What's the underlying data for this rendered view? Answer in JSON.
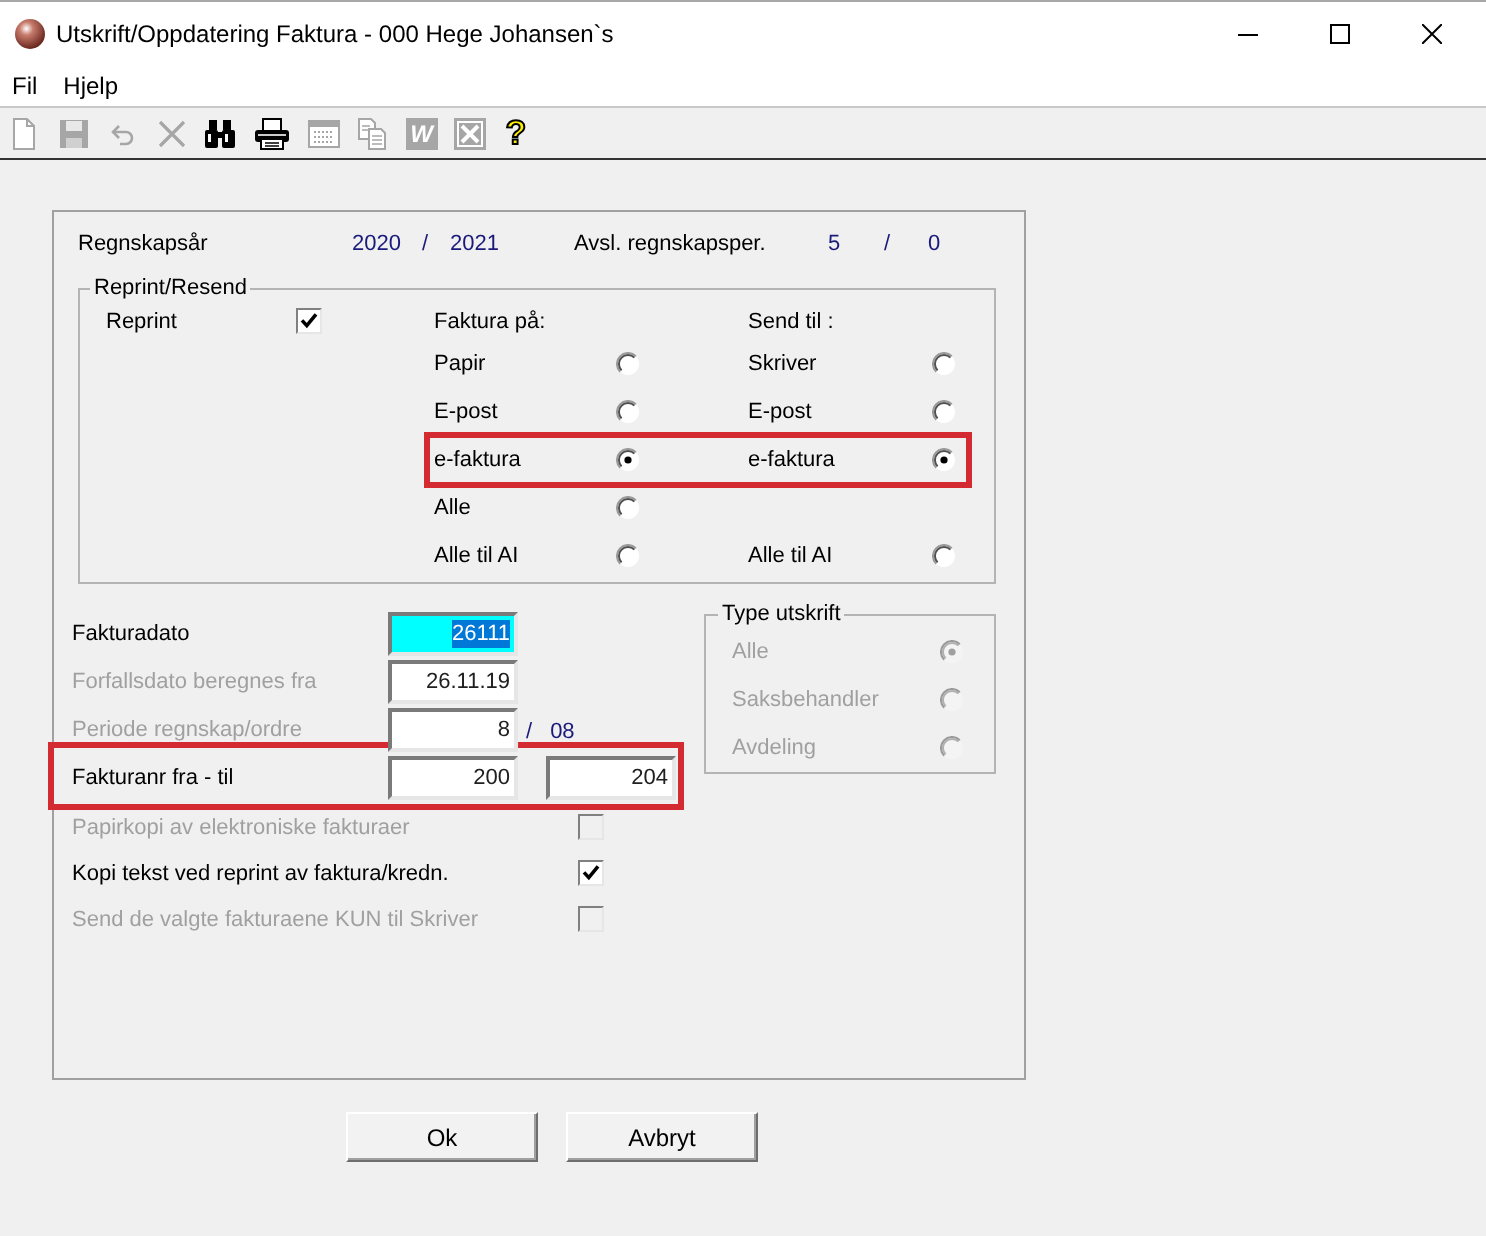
{
  "window": {
    "title": "Utskrift/Oppdatering Faktura - 000 Hege Johansen`s"
  },
  "menu": [
    {
      "label": "Fil"
    },
    {
      "label": "Hjelp"
    }
  ],
  "toolbar": [
    {
      "kind": "new",
      "disabled": true
    },
    {
      "kind": "save",
      "disabled": true
    },
    {
      "kind": "undo",
      "disabled": true
    },
    {
      "kind": "delete",
      "disabled": true
    },
    {
      "kind": "find",
      "disabled": false
    },
    {
      "kind": "print",
      "disabled": false
    },
    {
      "kind": "form",
      "disabled": true
    },
    {
      "kind": "copy",
      "disabled": true
    },
    {
      "kind": "word",
      "glyph": "W",
      "disabled": true
    },
    {
      "kind": "excel",
      "disabled": true
    },
    {
      "kind": "help",
      "glyph": "?",
      "disabled": false
    }
  ],
  "fiscal_year": {
    "label": "Regnskapsår",
    "start": "2020",
    "separator": "/",
    "end": "2021"
  },
  "closed_period": {
    "label": "Avsl. regnskapsper.",
    "start": "5",
    "separator": "/",
    "end": "0"
  },
  "reprint_group": {
    "title": "Reprint/Resend",
    "reprint": {
      "label": "Reprint",
      "checked": true
    },
    "faktura_pa_heading": "Faktura på:",
    "send_til_heading": "Send til :",
    "rows": [
      {
        "highlighted": false,
        "faktura_pa": {
          "label": "Papir",
          "selected": false
        },
        "send_til": {
          "label": "Skriver",
          "selected": false
        }
      },
      {
        "highlighted": false,
        "faktura_pa": {
          "label": "E-post",
          "selected": false
        },
        "send_til": {
          "label": "E-post",
          "selected": false
        }
      },
      {
        "highlighted": true,
        "faktura_pa": {
          "label": "e-faktura",
          "selected": true
        },
        "send_til": {
          "label": "e-faktura",
          "selected": true
        }
      },
      {
        "highlighted": false,
        "faktura_pa": {
          "label": "Alle",
          "selected": false
        }
      },
      {
        "highlighted": false,
        "faktura_pa": {
          "label": "Alle til AI",
          "selected": false
        },
        "send_til": {
          "label": "Alle til AI",
          "selected": false
        }
      }
    ]
  },
  "lower_fields": [
    {
      "label": "Fakturadato",
      "disabled": false,
      "highlighted": false,
      "inputs": [
        {
          "value": "26111",
          "focused": true
        }
      ]
    },
    {
      "label": "Forfallsdato beregnes fra",
      "disabled": true,
      "highlighted": false,
      "inputs": [
        {
          "value": "26.11.19",
          "focused": false
        }
      ]
    },
    {
      "label": "Periode regnskap/ordre",
      "disabled": true,
      "highlighted": false,
      "inputs": [
        {
          "value": "8",
          "focused": false
        }
      ],
      "separator": "/",
      "suffix": "08"
    },
    {
      "label": "Fakturanr fra - til",
      "disabled": false,
      "highlighted": true,
      "inputs": [
        {
          "value": "200",
          "focused": false
        },
        {
          "value": "204",
          "focused": false
        }
      ]
    }
  ],
  "checkboxes": [
    {
      "label": "Papirkopi av elektroniske fakturaer",
      "disabled": true,
      "checked": false
    },
    {
      "label": "Kopi tekst ved reprint av faktura/kredn.",
      "disabled": false,
      "checked": true
    },
    {
      "label": "Send de valgte fakturaene KUN til Skriver",
      "disabled": true,
      "checked": false
    }
  ],
  "type_utskrift": {
    "title": "Type utskrift",
    "disabled": true,
    "options": [
      {
        "label": "Alle",
        "selected": true
      },
      {
        "label": "Saksbehandler",
        "selected": false
      },
      {
        "label": "Avdeling",
        "selected": false
      }
    ]
  },
  "buttons": [
    {
      "label": "Ok"
    },
    {
      "label": "Avbryt"
    }
  ]
}
